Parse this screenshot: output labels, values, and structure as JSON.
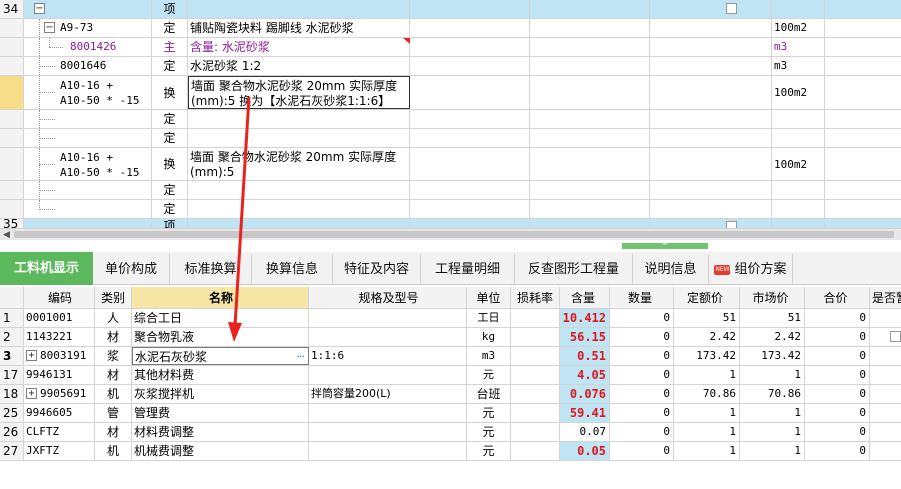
{
  "top_grid": {
    "rows": [
      {
        "num": "34",
        "tree_label": "",
        "type": "项",
        "name": "",
        "unit": ""
      },
      {
        "num": "",
        "code": "A9-73",
        "type": "定",
        "name": "铺贴陶瓷块料 踢脚线 水泥砂浆",
        "unit": "100m2"
      },
      {
        "num": "",
        "code": "8001426",
        "type": "主",
        "name": "含量: 水泥砂浆",
        "unit": "m3"
      },
      {
        "num": "",
        "code": "8001646",
        "type": "定",
        "name": "水泥砂浆 1:2",
        "unit": "m3"
      },
      {
        "num": "",
        "code_line1": "A10-16 +",
        "code_line2": "A10-50 * -15",
        "type": "换",
        "name_line1": "墙面 聚合物水泥砂浆 20mm  实际厚度",
        "name_line2": "(mm):5  换为【水泥石灰砂浆1:1:6】",
        "unit": "100m2"
      },
      {
        "num": "",
        "type": "定"
      },
      {
        "num": "",
        "type": "定"
      },
      {
        "num": "",
        "code_line1": "A10-16 +",
        "code_line2": "A10-50 * -15",
        "type": "换",
        "name_line1": "墙面 聚合物水泥砂浆 20mm  实际厚度",
        "name_line2": "(mm):5",
        "unit": "100m2"
      },
      {
        "num": "",
        "type": "定"
      },
      {
        "num": "",
        "type": "定"
      },
      {
        "num": "35",
        "type": "项"
      }
    ]
  },
  "tabs": [
    {
      "label": "工料机显示",
      "active": true
    },
    {
      "label": "单价构成"
    },
    {
      "label": "标准换算"
    },
    {
      "label": "换算信息"
    },
    {
      "label": "特征及内容"
    },
    {
      "label": "工程量明细"
    },
    {
      "label": "反查图形工程量"
    },
    {
      "label": "说明信息"
    },
    {
      "label": "组价方案",
      "badge": "NEW"
    }
  ],
  "bottom_grid": {
    "headers": {
      "code": "编码",
      "category": "类别",
      "name": "名称",
      "spec": "规格及型号",
      "unit": "单位",
      "loss": "损耗率",
      "content": "含量",
      "quantity": "数量",
      "quota_price": "定额价",
      "market_price": "市场价",
      "total": "合价",
      "flag": "是否暂"
    },
    "rows": [
      {
        "rn": "1",
        "code": "0001001",
        "cat": "人",
        "name": "综合工日",
        "spec": "",
        "unit": "工日",
        "content": "10.412",
        "qty": "0",
        "price": "51",
        "mkt": "51",
        "total": "0",
        "hl": true
      },
      {
        "rn": "2",
        "code": "1143221",
        "cat": "材",
        "name": "聚合物乳液",
        "spec": "",
        "unit": "kg",
        "content": "56.15",
        "qty": "0",
        "price": "2.42",
        "mkt": "2.42",
        "total": "0",
        "hl": true
      },
      {
        "rn": "3",
        "code": "8003191",
        "cat": "浆",
        "name": "水泥石灰砂浆",
        "spec": "1:1:6",
        "unit": "m3",
        "content": "0.51",
        "qty": "0",
        "price": "173.42",
        "mkt": "173.42",
        "total": "0",
        "hl": true
      },
      {
        "rn": "17",
        "code": "9946131",
        "cat": "材",
        "name": "其他材料费",
        "spec": "",
        "unit": "元",
        "content": "4.05",
        "qty": "0",
        "price": "1",
        "mkt": "1",
        "total": "0",
        "hl": true
      },
      {
        "rn": "18",
        "code": "9905691",
        "cat": "机",
        "name": "灰浆搅拌机",
        "spec": "拌筒容量200(L)",
        "unit": "台班",
        "content": "0.076",
        "qty": "0",
        "price": "70.86",
        "mkt": "70.86",
        "total": "0",
        "hl": true
      },
      {
        "rn": "25",
        "code": "9946605",
        "cat": "管",
        "name": "管理费",
        "spec": "",
        "unit": "元",
        "content": "59.41",
        "qty": "0",
        "price": "1",
        "mkt": "1",
        "total": "0",
        "hl": true
      },
      {
        "rn": "26",
        "code": "CLFTZ",
        "cat": "材",
        "name": "材料费调整",
        "spec": "",
        "unit": "元",
        "content": "0.07",
        "qty": "0",
        "price": "1",
        "mkt": "1",
        "total": "0",
        "hl": false
      },
      {
        "rn": "27",
        "code": "JXFTZ",
        "cat": "机",
        "name": "机械费调整",
        "spec": "",
        "unit": "元",
        "content": "0.05",
        "qty": "0",
        "price": "1",
        "mkt": "1",
        "total": "0",
        "hl": true
      }
    ]
  },
  "colors": {
    "tab_active": "#5cb85c",
    "highlight_cyan": "#bfe4f4",
    "content_red": "#e0151b",
    "arrow_red": "#e8231e",
    "name_header": "#f5e6a6"
  }
}
